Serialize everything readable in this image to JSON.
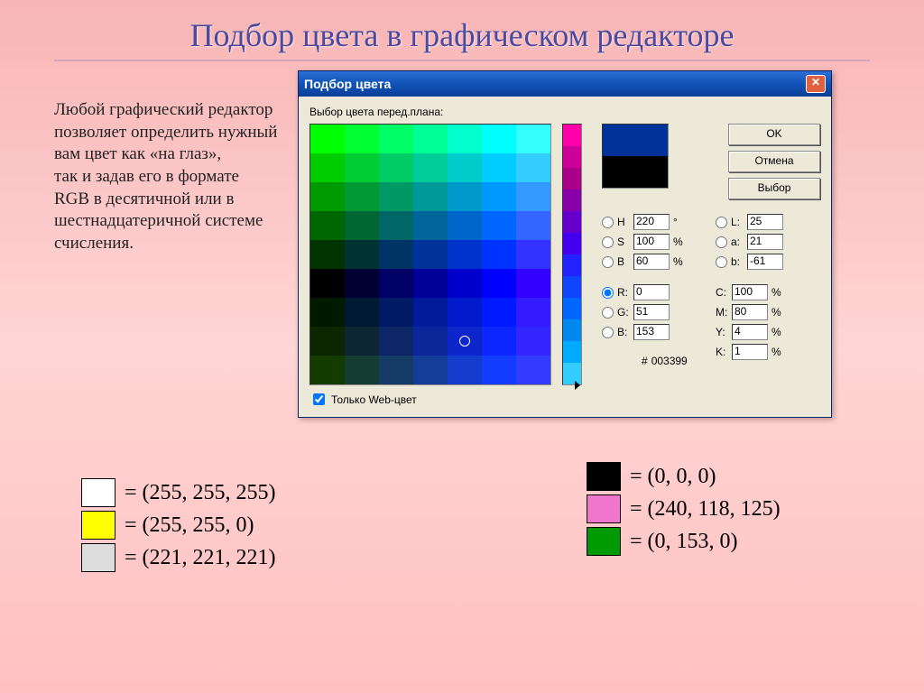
{
  "slide_title": "Подбор цвета в графическом редакторе",
  "description": "Любой графический редактор позволяет определить нужный вам цвет как «на глаз»,\nтак и задав его в формате\nRGB в десятичной или в шестнадцатеричной системе счисления.",
  "dialog": {
    "title": "Подбор цвета",
    "plane_label": "Выбор цвета перед.плана:",
    "buttons": {
      "ok": "OK",
      "cancel": "Отмена",
      "choose": "Выбор"
    },
    "hsb": {
      "h": "220",
      "s": "100",
      "b": "60",
      "h_unit": "°",
      "pct": "%"
    },
    "lab": {
      "l": "25",
      "a": "21",
      "b": "-61"
    },
    "rgb": {
      "r": "0",
      "g": "51",
      "b": "153"
    },
    "cmyk": {
      "c": "100",
      "m": "80",
      "y": "4",
      "k": "1"
    },
    "hex_label": "#",
    "hex": "003399",
    "labels": {
      "H": "H",
      "S": "S",
      "BB": "B",
      "L": "L:",
      "a": "a:",
      "b": "b:",
      "R": "R:",
      "G": "G:",
      "B": "B:",
      "C": "C:",
      "M": "M:",
      "Y": "Y:",
      "K": "K:"
    },
    "web_only": "Только Web-цвет"
  },
  "legend": {
    "left": [
      {
        "color": "#ffffff",
        "text": "= (255, 255, 255)"
      },
      {
        "color": "#ffff00",
        "text": "= (255, 255, 0)"
      },
      {
        "color": "#dddddd",
        "text": "= (221, 221, 221)"
      }
    ],
    "right": [
      {
        "color": "#000000",
        "text": "= (0, 0, 0)"
      },
      {
        "color": "#f076cd",
        "text": "= (240, 118, 125)"
      },
      {
        "color": "#009900",
        "text": "= (0, 153, 0)"
      }
    ]
  },
  "swatch_colors": [
    "#00ff00",
    "#00ff33",
    "#00ff66",
    "#00ff99",
    "#00ffcc",
    "#00ffff",
    "#33ffff",
    "#00cc00",
    "#00cc33",
    "#00cc66",
    "#00cc99",
    "#00cccc",
    "#00ccff",
    "#33ccff",
    "#009900",
    "#009933",
    "#009966",
    "#009999",
    "#0099cc",
    "#0099ff",
    "#3399ff",
    "#006600",
    "#006633",
    "#006666",
    "#006699",
    "#0066cc",
    "#0066ff",
    "#3366ff",
    "#003300",
    "#003333",
    "#003366",
    "#003399",
    "#0033cc",
    "#0033ff",
    "#3333ff",
    "#000000",
    "#000033",
    "#000066",
    "#000099",
    "#0000cc",
    "#0000ff",
    "#3300ff",
    "#001a00",
    "#001a33",
    "#001a66",
    "#001a99",
    "#001acc",
    "#001aff",
    "#331aff",
    "#0c2600",
    "#0c2633",
    "#0c2666",
    "#0c2699",
    "#0c26cc",
    "#0c26ff",
    "#3326ff",
    "#143c00",
    "#143c33",
    "#143c66",
    "#143c99",
    "#143ccc",
    "#143cff",
    "#333cff"
  ],
  "hue_colors": [
    "#ff00aa",
    "#cc0099",
    "#aa0088",
    "#8800aa",
    "#6600cc",
    "#4400ee",
    "#2222ff",
    "#1144ff",
    "#0066ff",
    "#0088ee",
    "#00aaff",
    "#33ccff"
  ]
}
